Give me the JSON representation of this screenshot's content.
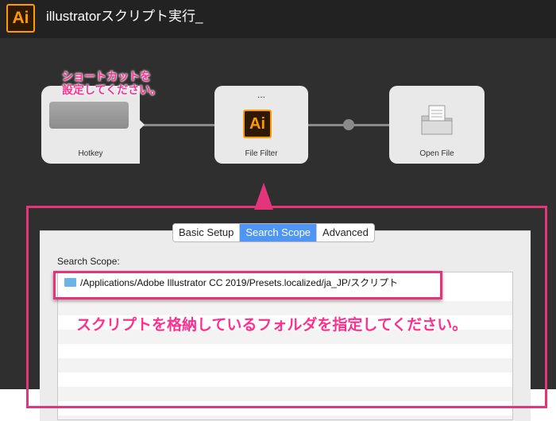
{
  "window": {
    "app_icon_text": "Ai",
    "title": "illustratorスクリプト実行_"
  },
  "workflow": {
    "hotkey": {
      "label": "Hotkey"
    },
    "file_filter": {
      "label": "File Filter",
      "indicator": "...",
      "icon_text": "Ai"
    },
    "open_file": {
      "label": "Open File"
    }
  },
  "annotations": {
    "hotkey_note": "ショートカットを\n設定してください。",
    "scope_note": "スクリプトを格納しているフォルダを指定してください。"
  },
  "tabs": [
    "Basic Setup",
    "Search Scope",
    "Advanced"
  ],
  "active_tab": "Search Scope",
  "search_scope": {
    "label": "Search Scope:",
    "paths": [
      "/Applications/Adobe Illustrator CC 2019/Presets.localized/ja_JP/スクリプト"
    ]
  },
  "colors": {
    "annotation": "#e5357a",
    "accent": "#4f95f4",
    "ai_orange": "#ff9a00"
  }
}
